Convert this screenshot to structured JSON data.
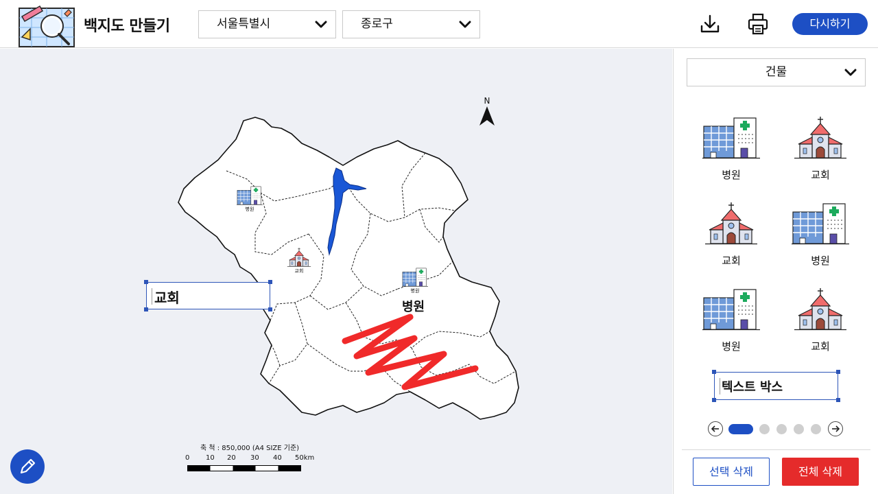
{
  "header": {
    "app_title": "백지도 만들기",
    "city_select": "서울특별시",
    "district_select": "종로구",
    "reset_label": "다시하기"
  },
  "icons": {
    "download": "download-icon",
    "print": "printer-icon",
    "edit": "pencil-icon"
  },
  "map": {
    "placed_items": [
      {
        "type": "hospital",
        "label": "병원"
      },
      {
        "type": "church",
        "label": "교회"
      },
      {
        "type": "hospital",
        "label": "병원"
      }
    ],
    "big_label": "병원",
    "textbox_text": "교회",
    "compass": "N",
    "scale_caption": "축 척 : 850,000 (A4 SIZE 기준)",
    "scale_ticks": [
      "0",
      "10",
      "20",
      "30",
      "40",
      "50km"
    ],
    "colors": {
      "river": "#1a57d6",
      "drawing": "#f02a2a",
      "background": "#eef0f5"
    }
  },
  "panel": {
    "category": "건물",
    "items": [
      {
        "type": "hospital",
        "label": "병원"
      },
      {
        "type": "church",
        "label": "교회"
      },
      {
        "type": "church",
        "label": "교회"
      },
      {
        "type": "hospital",
        "label": "병원"
      },
      {
        "type": "hospital",
        "label": "병원"
      },
      {
        "type": "church",
        "label": "교회"
      }
    ],
    "textbox_label": "텍스트 박스",
    "pager": {
      "pages": 5,
      "current": 1
    },
    "delete_selected": "선택 삭제",
    "delete_all": "전체 삭제"
  },
  "colors": {
    "accent": "#1d4fc4",
    "danger": "#e52b2b"
  }
}
